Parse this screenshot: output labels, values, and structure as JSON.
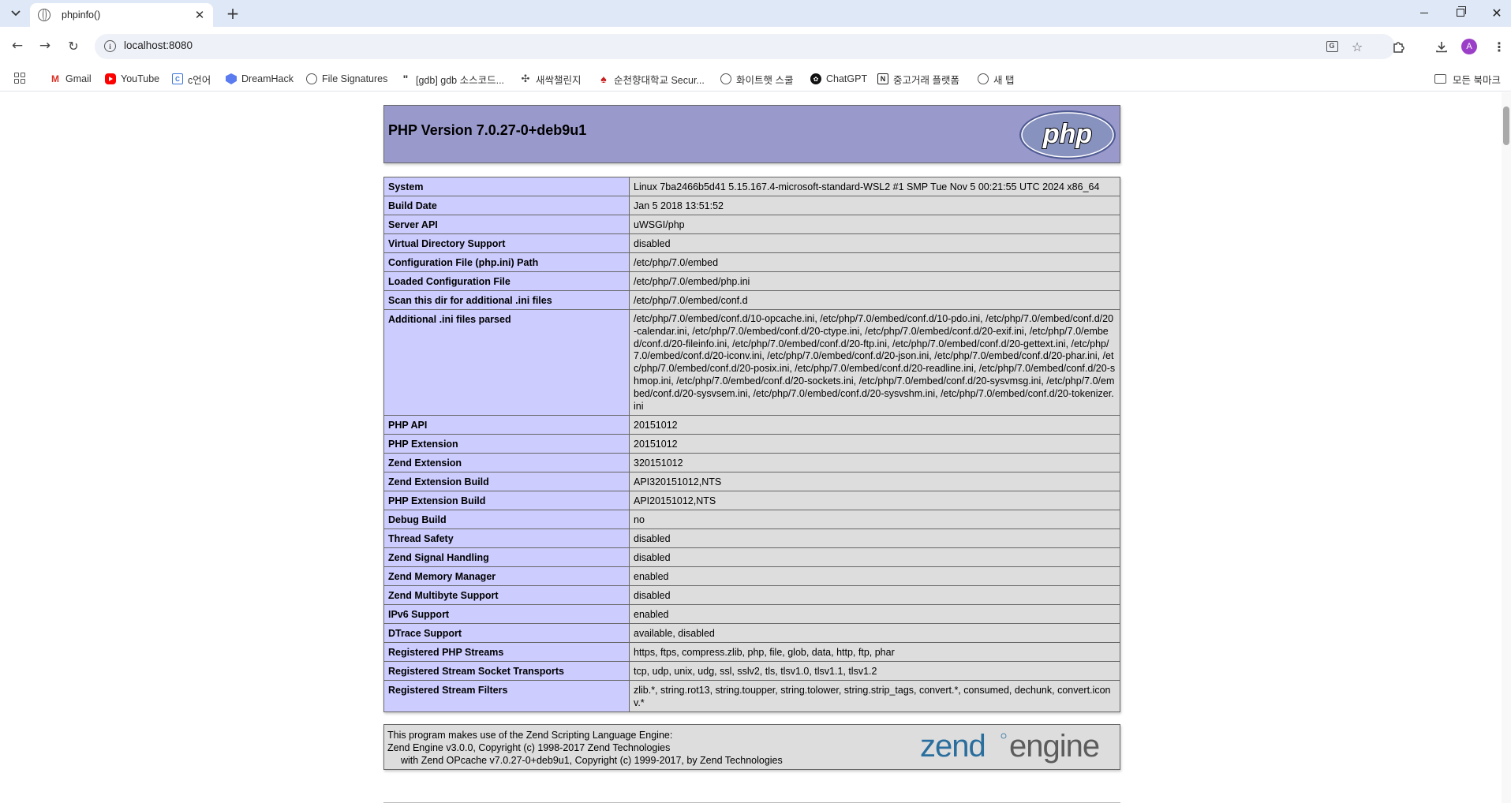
{
  "browser": {
    "tab": {
      "title": "phpinfo()",
      "close_glyph": "✕"
    },
    "new_tab_glyph": "+",
    "window_controls": {
      "close_glyph": "✕"
    },
    "nav": {
      "back_glyph": "←",
      "forward_glyph": "→",
      "reload_glyph": "↻"
    },
    "url": "localhost:8080",
    "profile_initial": "A",
    "bookmarks": [
      {
        "label": "Gmail",
        "icon": "gmail-icon",
        "glyph": "M"
      },
      {
        "label": "YouTube",
        "icon": "youtube-icon",
        "glyph": ""
      },
      {
        "label": "c언어",
        "icon": "c-lang-icon",
        "glyph": "C"
      },
      {
        "label": "DreamHack",
        "icon": "dreamhack-icon",
        "glyph": ""
      },
      {
        "label": "File Signatures",
        "icon": "globe-icon",
        "glyph": ""
      },
      {
        "label": "[gdb] gdb 소스코드...",
        "icon": "quote-icon",
        "glyph": "\""
      },
      {
        "label": "새싹챌린지",
        "icon": "gear-icon",
        "glyph": "✣"
      },
      {
        "label": "순천향대학교 Secur...",
        "icon": "schu-icon",
        "glyph": "♠"
      },
      {
        "label": "화이트햇 스쿨",
        "icon": "globe-icon",
        "glyph": ""
      },
      {
        "label": "ChatGPT",
        "icon": "chatgpt-icon",
        "glyph": "✿"
      },
      {
        "label": "중고거래 플랫폼",
        "icon": "notion-icon",
        "glyph": "N"
      },
      {
        "label": "새 탭",
        "icon": "globe-icon",
        "glyph": ""
      }
    ],
    "all_bookmarks_label": "모든 북마크"
  },
  "page": {
    "header_title": "PHP Version 7.0.27-0+deb9u1",
    "logo_text": "php",
    "rows": [
      {
        "key": "System",
        "value": "Linux 7ba2466b5d41 5.15.167.4-microsoft-standard-WSL2 #1 SMP Tue Nov 5 00:21:55 UTC 2024 x86_64"
      },
      {
        "key": "Build Date",
        "value": "Jan 5 2018 13:51:52"
      },
      {
        "key": "Server API",
        "value": "uWSGI/php"
      },
      {
        "key": "Virtual Directory Support",
        "value": "disabled"
      },
      {
        "key": "Configuration File (php.ini) Path",
        "value": "/etc/php/7.0/embed"
      },
      {
        "key": "Loaded Configuration File",
        "value": "/etc/php/7.0/embed/php.ini"
      },
      {
        "key": "Scan this dir for additional .ini files",
        "value": "/etc/php/7.0/embed/conf.d"
      },
      {
        "key": "Additional .ini files parsed",
        "value": "/etc/php/7.0/embed/conf.d/10-opcache.ini, /etc/php/7.0/embed/conf.d/10-pdo.ini, /etc/php/7.0/embed/conf.d/20-calendar.ini, /etc/php/7.0/embed/conf.d/20-ctype.ini, /etc/php/7.0/embed/conf.d/20-exif.ini, /etc/php/7.0/embed/conf.d/20-fileinfo.ini, /etc/php/7.0/embed/conf.d/20-ftp.ini, /etc/php/7.0/embed/conf.d/20-gettext.ini, /etc/php/7.0/embed/conf.d/20-iconv.ini, /etc/php/7.0/embed/conf.d/20-json.ini, /etc/php/7.0/embed/conf.d/20-phar.ini, /etc/php/7.0/embed/conf.d/20-posix.ini, /etc/php/7.0/embed/conf.d/20-readline.ini, /etc/php/7.0/embed/conf.d/20-shmop.ini, /etc/php/7.0/embed/conf.d/20-sockets.ini, /etc/php/7.0/embed/conf.d/20-sysvmsg.ini, /etc/php/7.0/embed/conf.d/20-sysvsem.ini, /etc/php/7.0/embed/conf.d/20-sysvshm.ini, /etc/php/7.0/embed/conf.d/20-tokenizer.ini",
        "multi": true
      },
      {
        "key": "PHP API",
        "value": "20151012"
      },
      {
        "key": "PHP Extension",
        "value": "20151012"
      },
      {
        "key": "Zend Extension",
        "value": "320151012"
      },
      {
        "key": "Zend Extension Build",
        "value": "API320151012,NTS"
      },
      {
        "key": "PHP Extension Build",
        "value": "API20151012,NTS"
      },
      {
        "key": "Debug Build",
        "value": "no"
      },
      {
        "key": "Thread Safety",
        "value": "disabled"
      },
      {
        "key": "Zend Signal Handling",
        "value": "disabled"
      },
      {
        "key": "Zend Memory Manager",
        "value": "enabled"
      },
      {
        "key": "Zend Multibyte Support",
        "value": "disabled"
      },
      {
        "key": "IPv6 Support",
        "value": "enabled"
      },
      {
        "key": "DTrace Support",
        "value": "available, disabled"
      },
      {
        "key": "Registered PHP Streams",
        "value": "https, ftps, compress.zlib, php, file, glob, data, http, ftp, phar"
      },
      {
        "key": "Registered Stream Socket Transports",
        "value": "tcp, udp, unix, udg, ssl, sslv2, tls, tlsv1.0, tlsv1.1, tlsv1.2"
      },
      {
        "key": "Registered Stream Filters",
        "value": "zlib.*, string.rot13, string.toupper, string.tolower, string.strip_tags, convert.*, consumed, dechunk, convert.iconv.*"
      }
    ],
    "zend": {
      "line1": "This program makes use of the Zend Scripting Language Engine:",
      "line2": "Zend Engine v3.0.0, Copyright (c) 1998-2017 Zend Technologies",
      "line3": "with Zend OPcache v7.0.27-0+deb9u1, Copyright (c) 1999-2017, by Zend Technologies",
      "logo_word1": "zend",
      "logo_word2": "engine"
    }
  },
  "colors": {
    "header_bg": "#9999cc",
    "key_cell_bg": "#ccccff",
    "value_cell_bg": "#dddddd",
    "php_logo_bg": "#777bb3",
    "zend_blue": "#2a6e9e"
  }
}
